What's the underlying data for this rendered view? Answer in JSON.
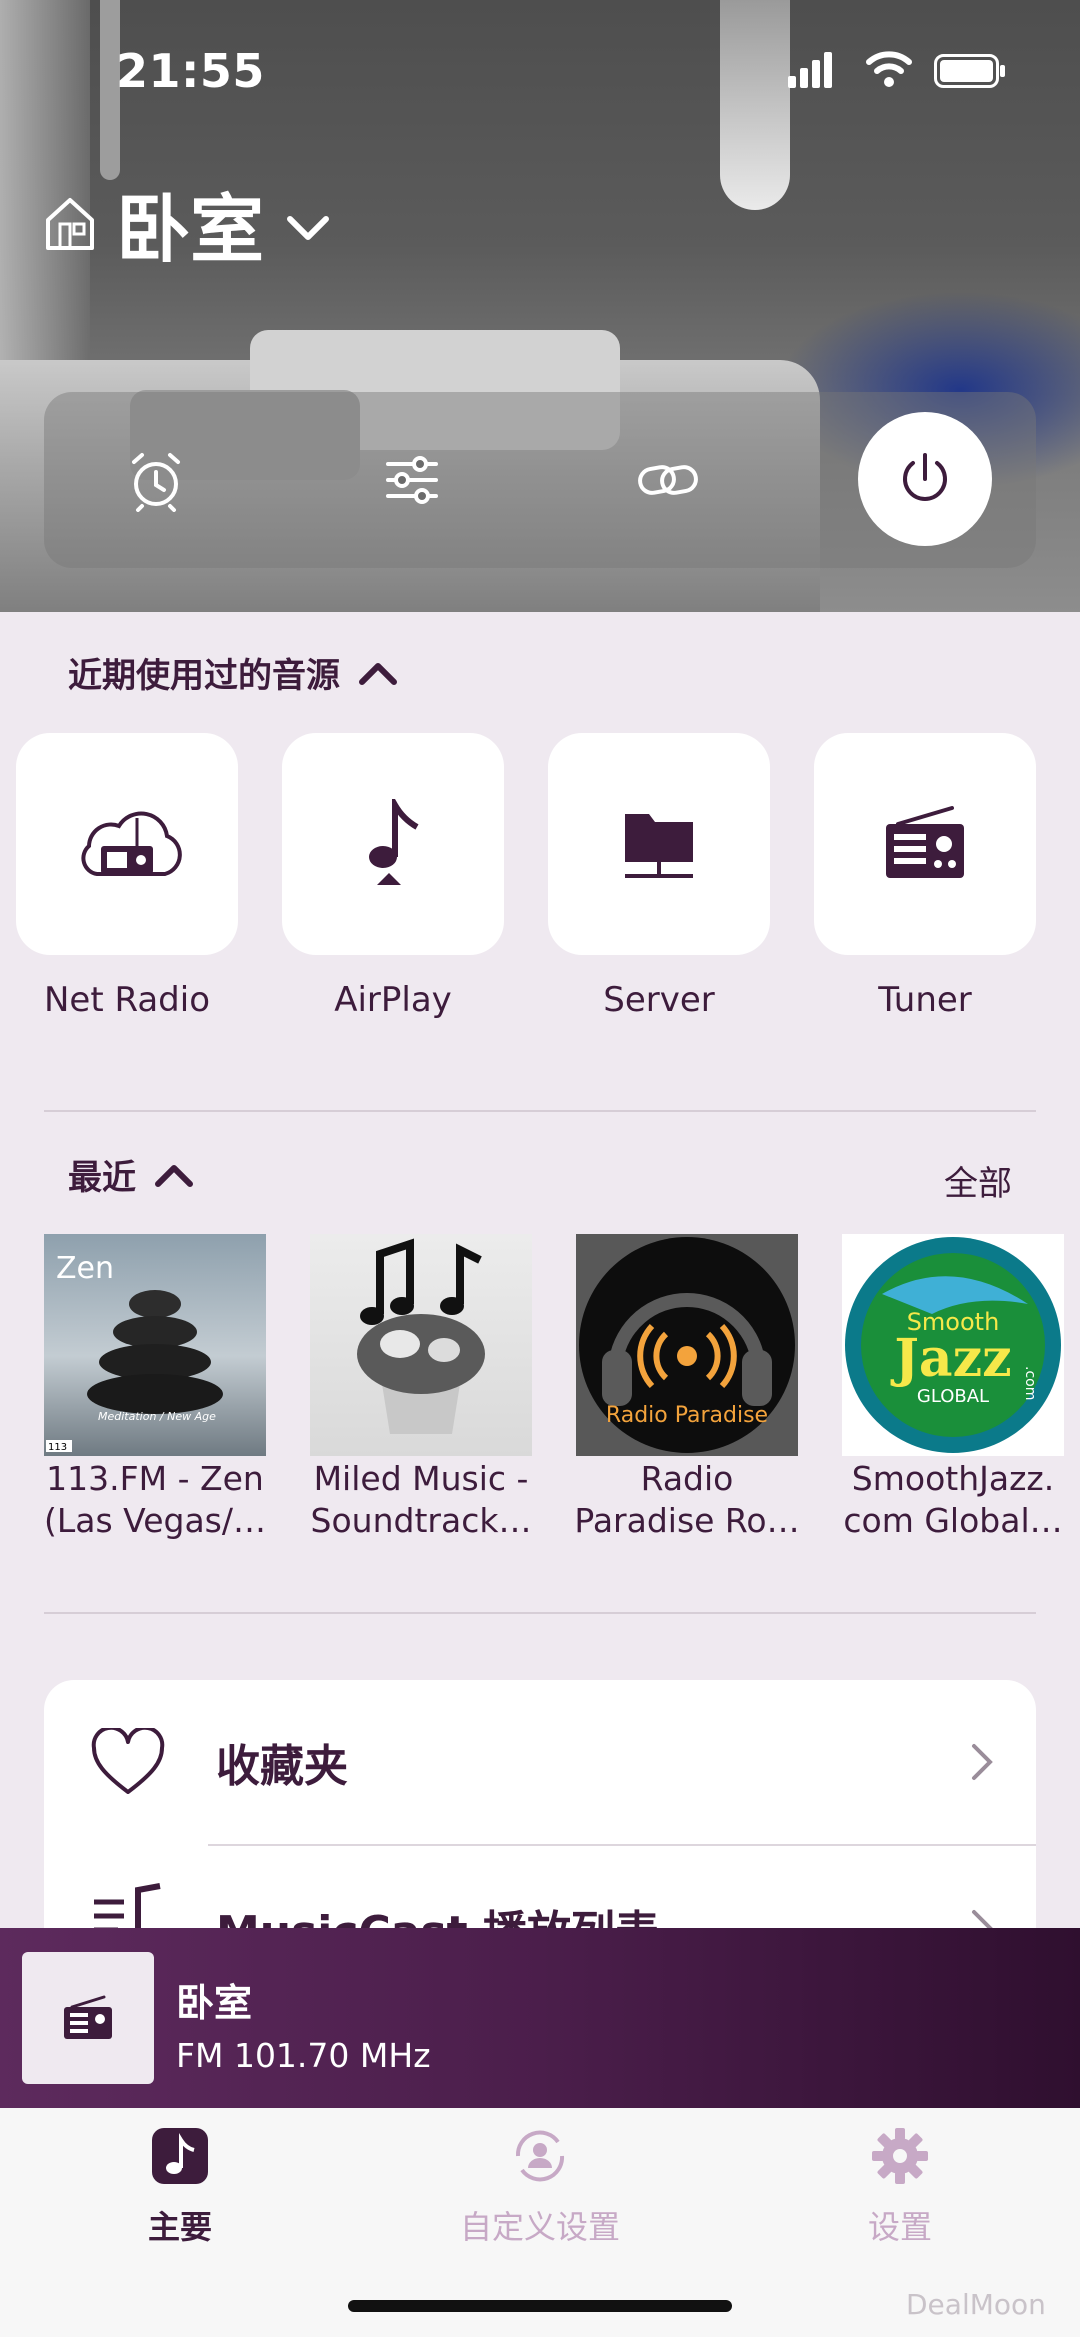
{
  "status_bar": {
    "time": "21:55"
  },
  "header": {
    "room_name": "卧室"
  },
  "controls": {
    "icons": [
      "alarm-clock-icon",
      "equalizer-icon",
      "link-icon",
      "power-icon"
    ]
  },
  "sources": {
    "title": "近期使用过的音源",
    "items": [
      {
        "label": "Net Radio",
        "icon": "net-radio-icon"
      },
      {
        "label": "AirPlay",
        "icon": "airplay-note-icon"
      },
      {
        "label": "Server",
        "icon": "server-folder-icon"
      },
      {
        "label": "Tuner",
        "icon": "tuner-radio-icon"
      }
    ]
  },
  "recent": {
    "title": "最近",
    "see_all": "全部",
    "items": [
      {
        "line1": "113.FM - Zen",
        "line2": "(Las Vegas/…",
        "art_text": "Zen",
        "art_caption": "Meditation / New Age",
        "art_tag": "113"
      },
      {
        "line1": "Miled Music -",
        "line2": "Soundtrack…"
      },
      {
        "line1": "Radio",
        "line2": "Paradise Ro…",
        "art_text": "Radio Paradise"
      },
      {
        "line1": "SmoothJazz.",
        "line2": "com Global…",
        "art_text_1": "Smooth",
        "art_text_2": "Jazz",
        "art_text_3": "GLOBAL",
        "art_text_4": ".com"
      }
    ]
  },
  "menu": {
    "favorites": "收藏夹",
    "playlist": "MusicCast 播放列表"
  },
  "player": {
    "room": "卧室",
    "station": "FM 101.70 MHz"
  },
  "tabs": [
    {
      "label": "主要",
      "active": true
    },
    {
      "label": "自定义设置",
      "active": false
    },
    {
      "label": "设置",
      "active": false
    }
  ],
  "watermark": "DealMoon",
  "colors": {
    "brand": "#3d1c3c",
    "background": "#efe9f0",
    "player": "#4b1e4b",
    "tab_inactive": "#c7a9c6"
  }
}
